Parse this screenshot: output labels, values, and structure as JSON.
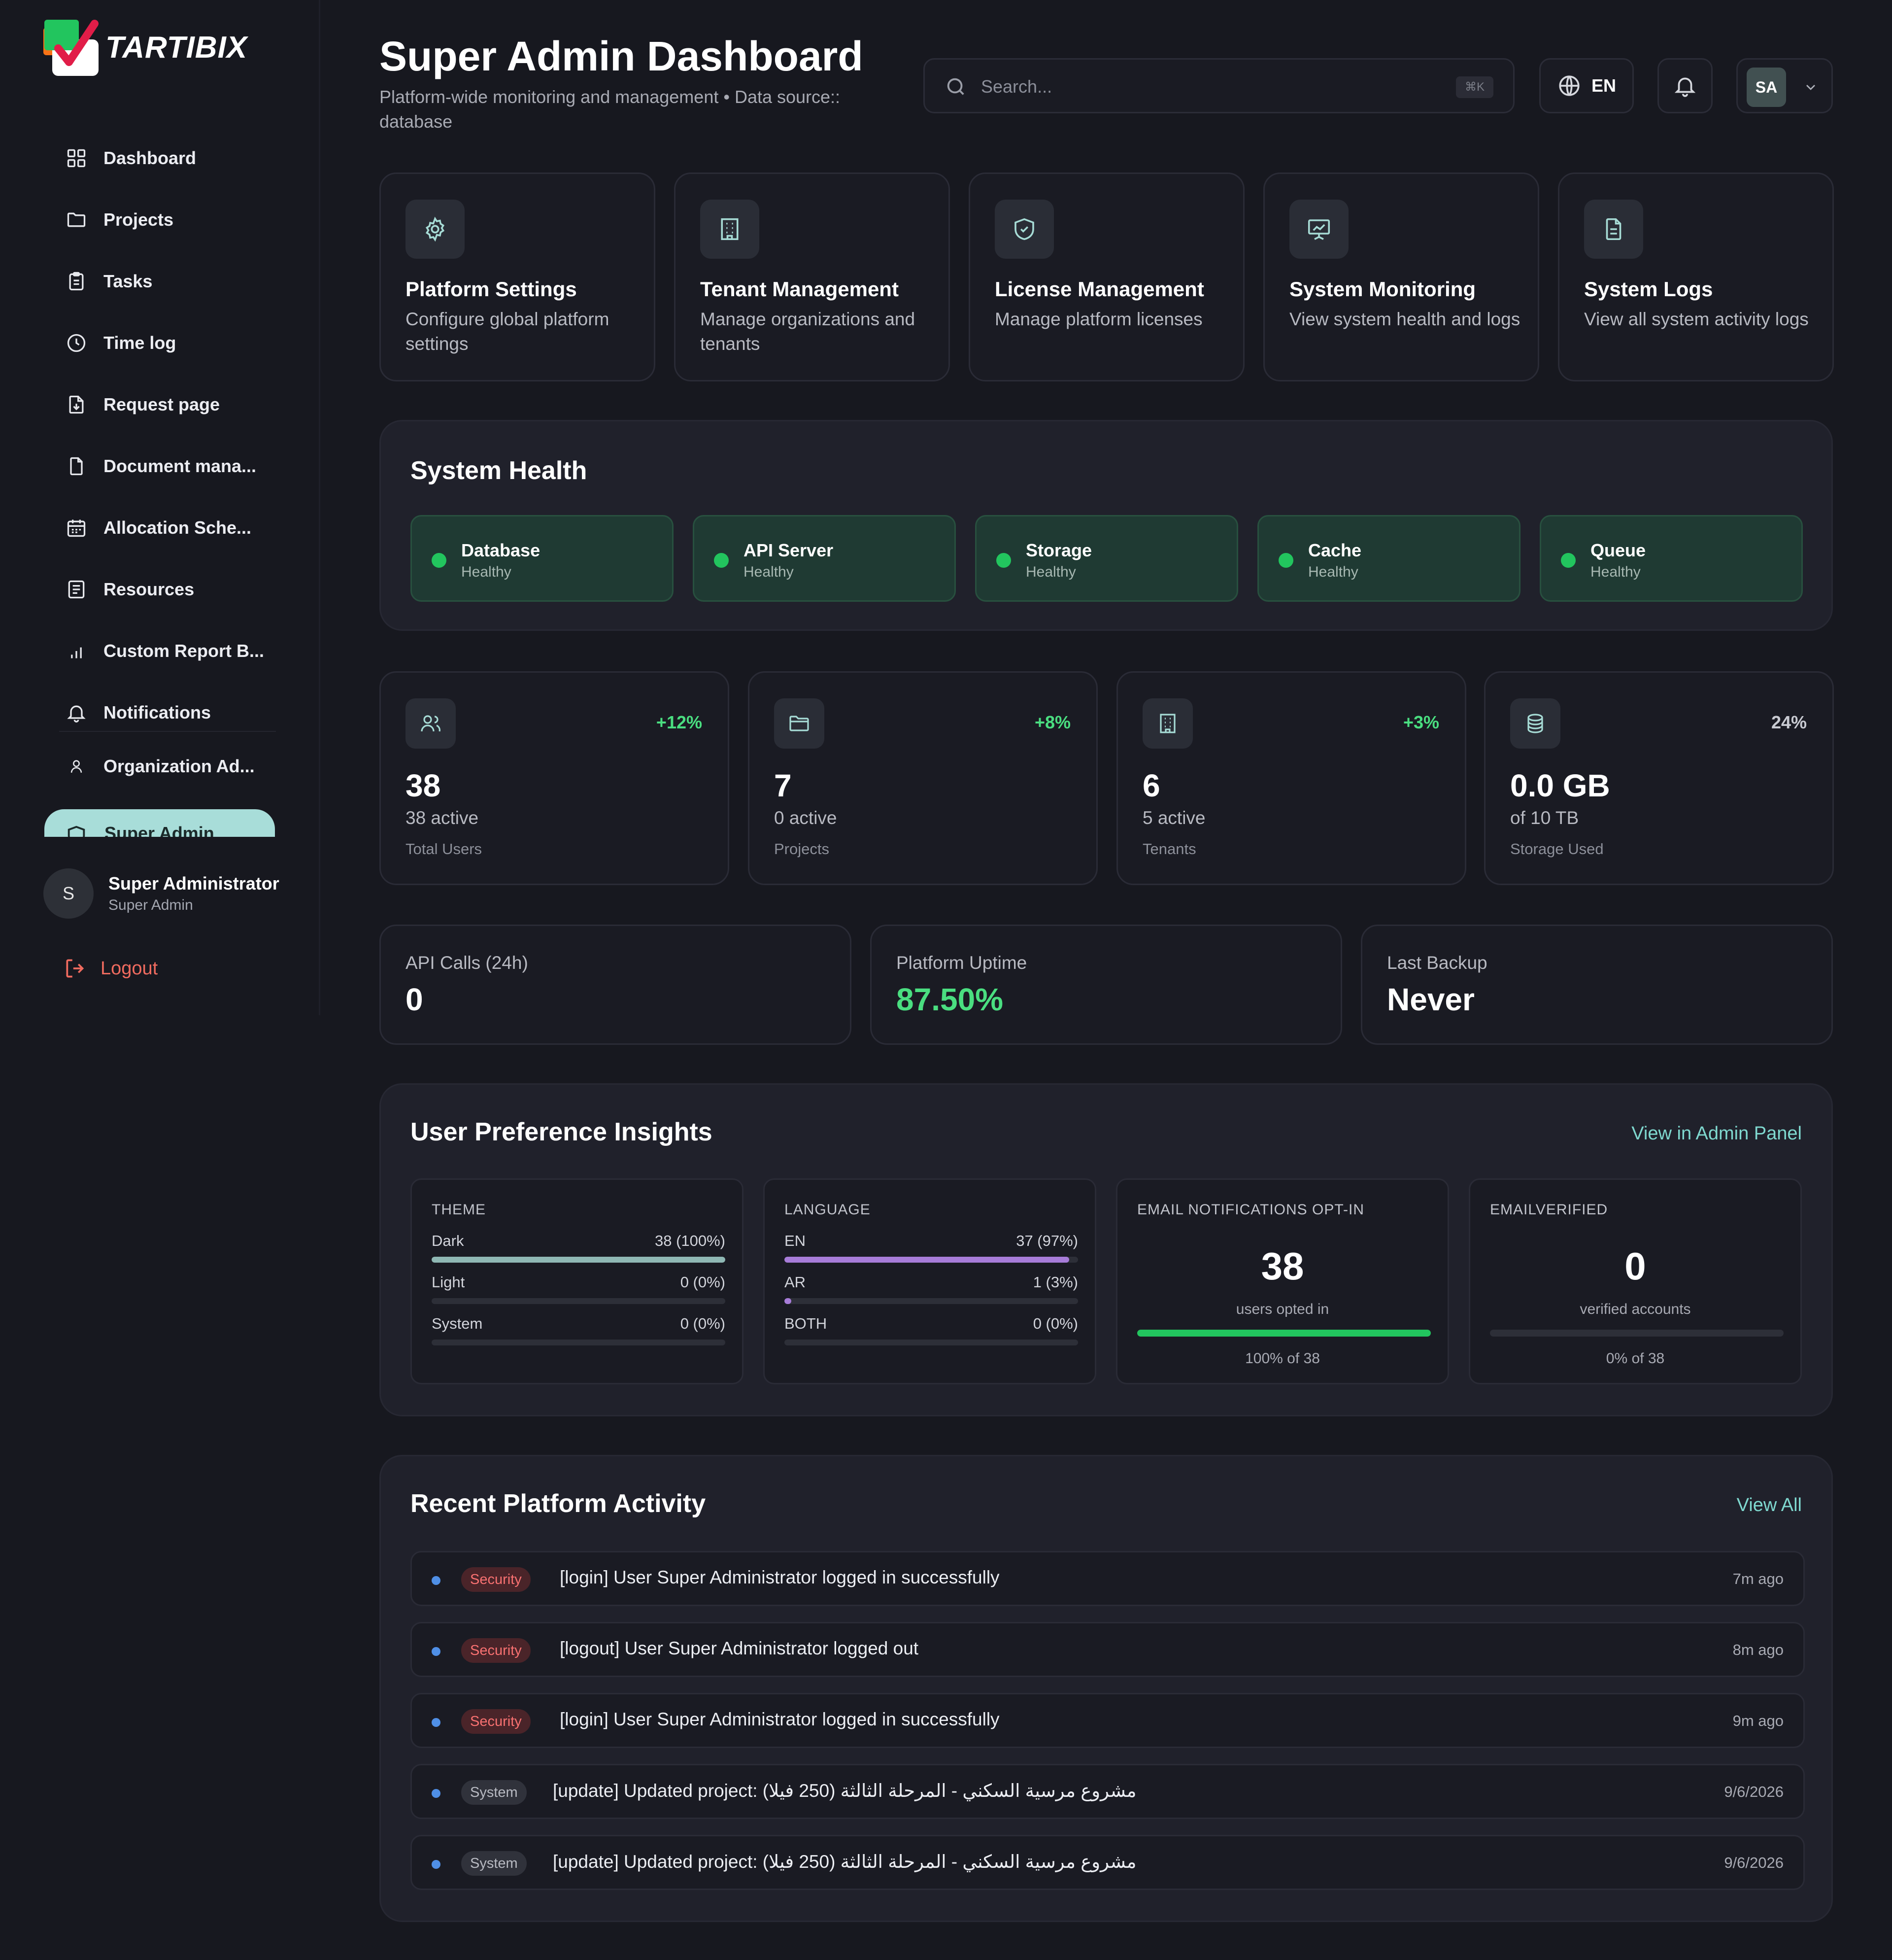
{
  "brand": {
    "name": "TARTIBIX"
  },
  "sidebar": {
    "items": [
      {
        "label": "Dashboard",
        "icon": "grid-icon"
      },
      {
        "label": "Projects",
        "icon": "folder-icon"
      },
      {
        "label": "Tasks",
        "icon": "clipboard-icon"
      },
      {
        "label": "Time log",
        "icon": "clock-icon"
      },
      {
        "label": "Request page",
        "icon": "file-download-icon"
      },
      {
        "label": "Document mana...",
        "icon": "file-icon"
      },
      {
        "label": "Allocation Sche...",
        "icon": "calendar-icon"
      },
      {
        "label": "Resources",
        "icon": "list-icon"
      },
      {
        "label": "Custom Report B...",
        "icon": "bar-chart-icon"
      },
      {
        "label": "Notifications",
        "icon": "bell-icon"
      }
    ],
    "org_item": {
      "label": "Organization Ad...",
      "icon": "user-icon"
    },
    "active_item": {
      "label": "Super Admin",
      "icon": "shield-icon"
    },
    "user": {
      "initial": "S",
      "name": "Super Administrator",
      "role": "Super Admin"
    },
    "logout_label": "Logout"
  },
  "header": {
    "title": "Super Admin Dashboard",
    "subtitle": "Platform-wide monitoring and management • Data source:: database",
    "search": {
      "placeholder": "Search...",
      "shortcut": "⌘K"
    },
    "language": "EN",
    "profile_initials": "SA"
  },
  "quick_cards": [
    {
      "title": "Platform Settings",
      "desc": "Configure global platform settings",
      "icon": "gear-icon"
    },
    {
      "title": "Tenant Management",
      "desc": "Manage organizations and tenants",
      "icon": "building-icon"
    },
    {
      "title": "License Management",
      "desc": "Manage platform licenses",
      "icon": "shield-check-icon"
    },
    {
      "title": "System Monitoring",
      "desc": "View system health and logs",
      "icon": "monitor-chart-icon"
    },
    {
      "title": "System Logs",
      "desc": "View all system activity logs",
      "icon": "document-icon"
    }
  ],
  "system_health": {
    "title": "System Health",
    "status_color": "#22c55e",
    "items": [
      {
        "name": "Database",
        "status": "Healthy"
      },
      {
        "name": "API Server",
        "status": "Healthy"
      },
      {
        "name": "Storage",
        "status": "Healthy"
      },
      {
        "name": "Cache",
        "status": "Healthy"
      },
      {
        "name": "Queue",
        "status": "Healthy"
      }
    ]
  },
  "stats": [
    {
      "value": "38",
      "sub": "38 active",
      "label": "Total Users",
      "change": "+12%",
      "change_color": "#4ade80",
      "icon": "users-icon"
    },
    {
      "value": "7",
      "sub": "0 active",
      "label": "Projects",
      "change": "+8%",
      "change_color": "#4ade80",
      "icon": "folder-icon"
    },
    {
      "value": "6",
      "sub": "5 active",
      "label": "Tenants",
      "change": "+3%",
      "change_color": "#4ade80",
      "icon": "building-icon"
    },
    {
      "value": "0.0 GB",
      "sub": "of 10 TB",
      "label": "Storage Used",
      "change": "24%",
      "change_color": "#c9cbd2",
      "icon": "database-icon"
    }
  ],
  "metrics": [
    {
      "label": "API Calls (24h)",
      "value": "0",
      "color": "#ffffff"
    },
    {
      "label": "Platform Uptime",
      "value": "87.50%",
      "color": "#4ade80"
    },
    {
      "label": "Last Backup",
      "value": "Never",
      "color": "#ffffff"
    }
  ],
  "insights": {
    "title": "User Preference Insights",
    "link": "View in Admin Panel",
    "theme": {
      "heading": "THEME",
      "rows": [
        {
          "label": "Dark",
          "value": "38 (100%)",
          "fraction": 1.0,
          "color": "#8fb8b4"
        },
        {
          "label": "Light",
          "value": "0 (0%)",
          "fraction": 0.0,
          "color": "#8fb8b4"
        },
        {
          "label": "System",
          "value": "0 (0%)",
          "fraction": 0.0,
          "color": "#8fb8b4"
        }
      ]
    },
    "language": {
      "heading": "LANGUAGE",
      "rows": [
        {
          "label": "EN",
          "value": "37 (97%)",
          "fraction": 0.97,
          "color": "#a77cd8"
        },
        {
          "label": "AR",
          "value": "1 (3%)",
          "fraction": 0.03,
          "color": "#a77cd8"
        },
        {
          "label": "BOTH",
          "value": "0 (0%)",
          "fraction": 0.0,
          "color": "#a77cd8"
        }
      ]
    },
    "email_opt_in": {
      "heading": "EMAIL NOTIFICATIONS OPT-IN",
      "value": "38",
      "caption": "users opted in",
      "fraction": 1.0,
      "footer": "100% of 38"
    },
    "email_verified": {
      "heading": "EMAILVERIFIED",
      "value": "0",
      "caption": "verified accounts",
      "fraction": 0.0,
      "footer": "0% of 38"
    }
  },
  "activity": {
    "title": "Recent Platform Activity",
    "link": "View All",
    "items": [
      {
        "badge": "Security",
        "type": "security",
        "message": "[login] User Super Administrator logged in successfully",
        "time": "7m ago"
      },
      {
        "badge": "Security",
        "type": "security",
        "message": "[logout] User Super Administrator logged out",
        "time": "8m ago"
      },
      {
        "badge": "Security",
        "type": "security",
        "message": "[login] User Super Administrator logged in successfully",
        "time": "9m ago"
      },
      {
        "badge": "System",
        "type": "system",
        "message": "[update] Updated project: مشروع مرسية السكني - المرحلة الثالثة (250 فيلا)",
        "time": "9/6/2026"
      },
      {
        "badge": "System",
        "type": "system",
        "message": "[update] Updated project: مشروع مرسية السكني - المرحلة الثالثة (250 فيلا)",
        "time": "9/6/2026"
      }
    ]
  }
}
